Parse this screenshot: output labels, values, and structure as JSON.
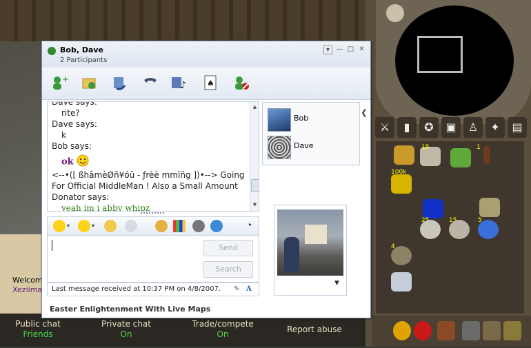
{
  "messenger": {
    "title": "Bob, Dave",
    "participants_count": "2 Participants",
    "window_controls": {
      "menu": "▾",
      "minimize": "—",
      "maximize": "□",
      "close": "✕"
    },
    "toolbar_icons": [
      "invite-contact-icon",
      "send-files-icon",
      "video-call-icon",
      "phone-call-icon",
      "activities-icon",
      "games-icon",
      "block-icon"
    ],
    "conversation": [
      {
        "type": "sender",
        "text": "Dave says:"
      },
      {
        "type": "msg",
        "text": "rite?"
      },
      {
        "type": "sender",
        "text": "Dave says:"
      },
      {
        "type": "msg",
        "text": "k"
      },
      {
        "type": "sender",
        "text": "Bob says:"
      },
      {
        "type": "msg-styled",
        "text": "ok",
        "emoticon": "smiley-icon"
      },
      {
        "type": "sender",
        "text": "<--•([ ßhâmèØñ¥óû - ƒrèè mmïñg ])•--> Going For Official MiddleMan ! Also a Small Amount Donator says:"
      },
      {
        "type": "msg-green",
        "text": "yeah im i abby whipz"
      }
    ],
    "input": {
      "value": ""
    },
    "send_label": "Send",
    "search_label": "Search",
    "status_text": "Last message received at 10:37 PM on 4/8/2007.",
    "ad_text": "Easter Enlightenment With Live Maps",
    "participants": [
      {
        "name": "Bob"
      },
      {
        "name": "Dave"
      }
    ]
  },
  "game": {
    "chat_welcome": "Welcom",
    "chat_name": "Xeziima",
    "bottom_bar": [
      {
        "label": "Public chat",
        "state": "Friends"
      },
      {
        "label": "Private chat",
        "state": "On"
      },
      {
        "label": "Trade/compete",
        "state": "On"
      },
      {
        "label": "Report abuse",
        "state": ""
      }
    ],
    "inventory_counts": [
      "15",
      "1",
      "100k",
      "25",
      "15",
      "5",
      "4"
    ]
  },
  "colors": {
    "green_text": "#2f7f14",
    "purple_text": "#6a1b7a",
    "accent_blue": "#1f5fbf"
  }
}
